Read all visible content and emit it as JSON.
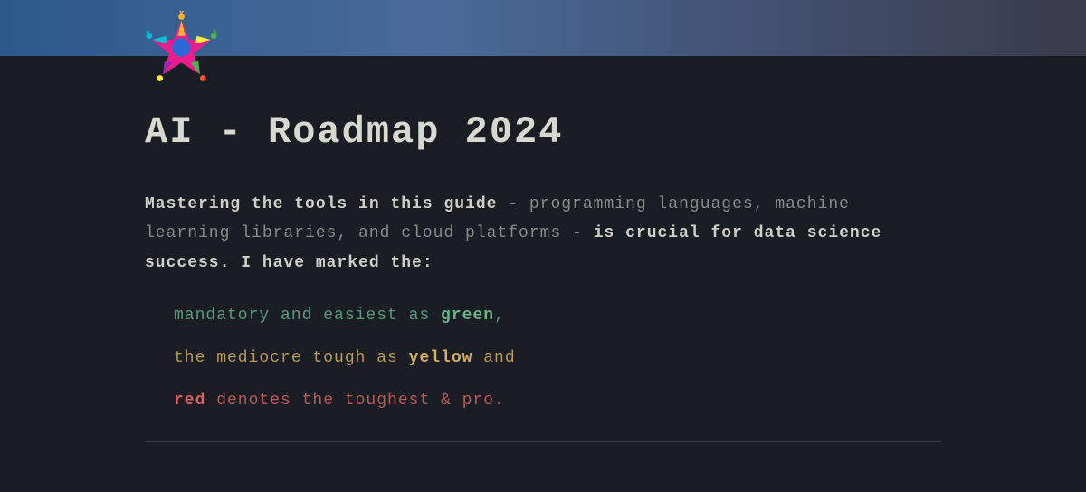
{
  "title": "AI - Roadmap 2024",
  "description": {
    "bold1": "Mastering the tools in this guide",
    "plain1": " - programming languages, machine learning libraries, and cloud platforms - ",
    "bold2": "is crucial for data science success. I have marked the:"
  },
  "legend": {
    "green": {
      "prefix": "mandatory and easiest as ",
      "keyword": "green",
      "suffix": ","
    },
    "yellow": {
      "prefix": "the mediocre tough as ",
      "keyword": "yellow",
      "suffix": " and"
    },
    "red": {
      "keyword": "red",
      "suffix": " denotes the toughest & pro."
    }
  }
}
